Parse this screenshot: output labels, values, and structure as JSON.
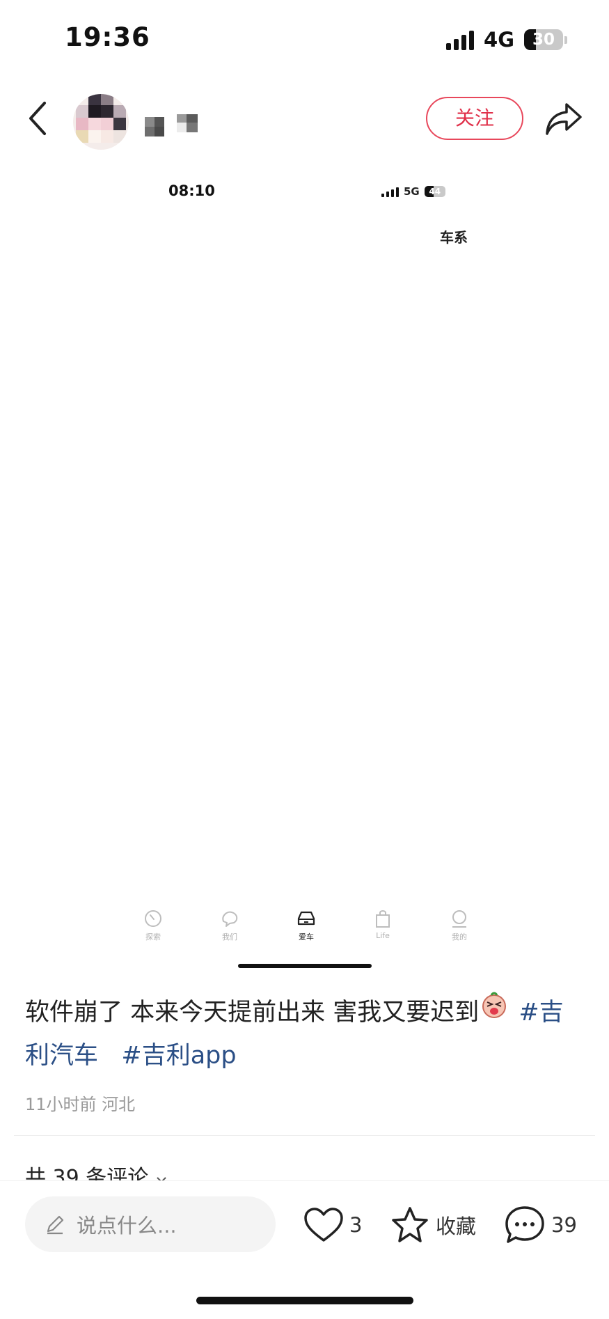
{
  "status_bar": {
    "time": "19:36",
    "network": "4G",
    "battery": "30",
    "battery_level": 0.3
  },
  "header": {
    "follow_label": "关注"
  },
  "embedded_screen": {
    "time": "08:10",
    "network": "5G",
    "battery": "44",
    "battery_level": 0.44,
    "top_tab": "车系",
    "nav": [
      {
        "label": "探索",
        "icon": "explore-icon"
      },
      {
        "label": "我们",
        "icon": "chat-bubble-icon"
      },
      {
        "label": "爱车",
        "icon": "car-icon"
      },
      {
        "label": "Life",
        "icon": "shopping-bag-icon"
      },
      {
        "label": "我的",
        "icon": "profile-icon"
      }
    ]
  },
  "post": {
    "text": "软件崩了 本来今天提前出来 害我又要迟到",
    "emoji": "crying-emoji",
    "tags": [
      "#吉利汽车",
      "#吉利app"
    ],
    "time": "11小时前",
    "location": "河北"
  },
  "comments_header": "共 39 条评论",
  "bottom_bar": {
    "input_placeholder": "说点什么...",
    "likes": "3",
    "collect_label": "收藏",
    "comments": "39"
  }
}
